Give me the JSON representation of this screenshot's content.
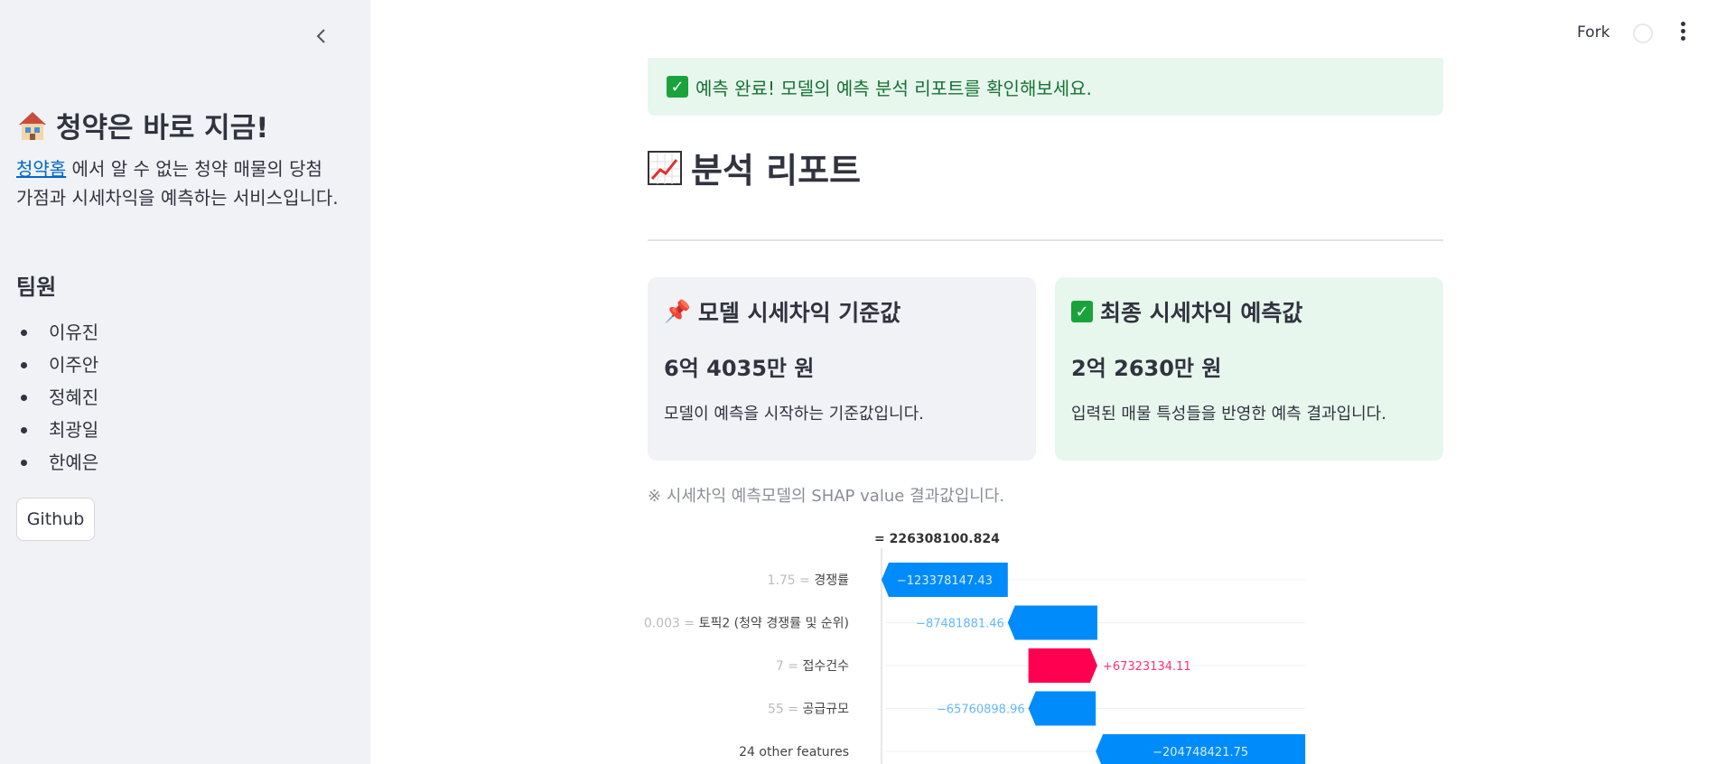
{
  "sidebar": {
    "app_title": "청약은 바로 지금!",
    "description_link": "청약홈",
    "description_text": " 에서 알 수 없는 청약 매물의 당첨 가점과 시세차익을 예측하는 서비스입니다.",
    "team_title": "팀원",
    "team_members": [
      "이유진",
      "이주안",
      "정혜진",
      "최광일",
      "한예은"
    ],
    "github_button": "Github"
  },
  "topbar": {
    "fork_label": "Fork"
  },
  "main": {
    "alert_text": "예측 완료! 모델의 예측 분석 리포트를 확인해보세요.",
    "report_title": "분석 리포트",
    "base_card": {
      "title": "모델 시세차익 기준값",
      "value": "6억 4035만 원",
      "description": "모델이 예측을 시작하는 기준값입니다."
    },
    "final_card": {
      "title": "최종 시세차익 예측값",
      "value": "2억 2630만 원",
      "description": "입력된 매물 특성들을 반영한 예측 결과입니다."
    },
    "shap_note": "※ 시세차익 예측모델의 SHAP value 결과값입니다."
  },
  "chart_data": {
    "type": "waterfall",
    "top_label": "= 226308100.824",
    "features": [
      {
        "value": "1.75",
        "name": "경쟁률",
        "shap": -123378147.43,
        "label": "−123378147.43"
      },
      {
        "value": "0.003",
        "name": "토픽2 (청약 경쟁률 및 순위)",
        "shap": -87481881.46,
        "label": "−87481881.46"
      },
      {
        "value": "7",
        "name": "접수건수",
        "shap": 67323134.11,
        "label": "+67323134.11"
      },
      {
        "value": "55",
        "name": "공급규모",
        "shap": -65760898.96,
        "label": "−65760898.96"
      },
      {
        "value": "",
        "name": "24 other features",
        "shap": -204748421.75,
        "label": "−204748421.75"
      }
    ],
    "colors": {
      "negative": "#008bfb",
      "positive": "#ff0051"
    }
  }
}
